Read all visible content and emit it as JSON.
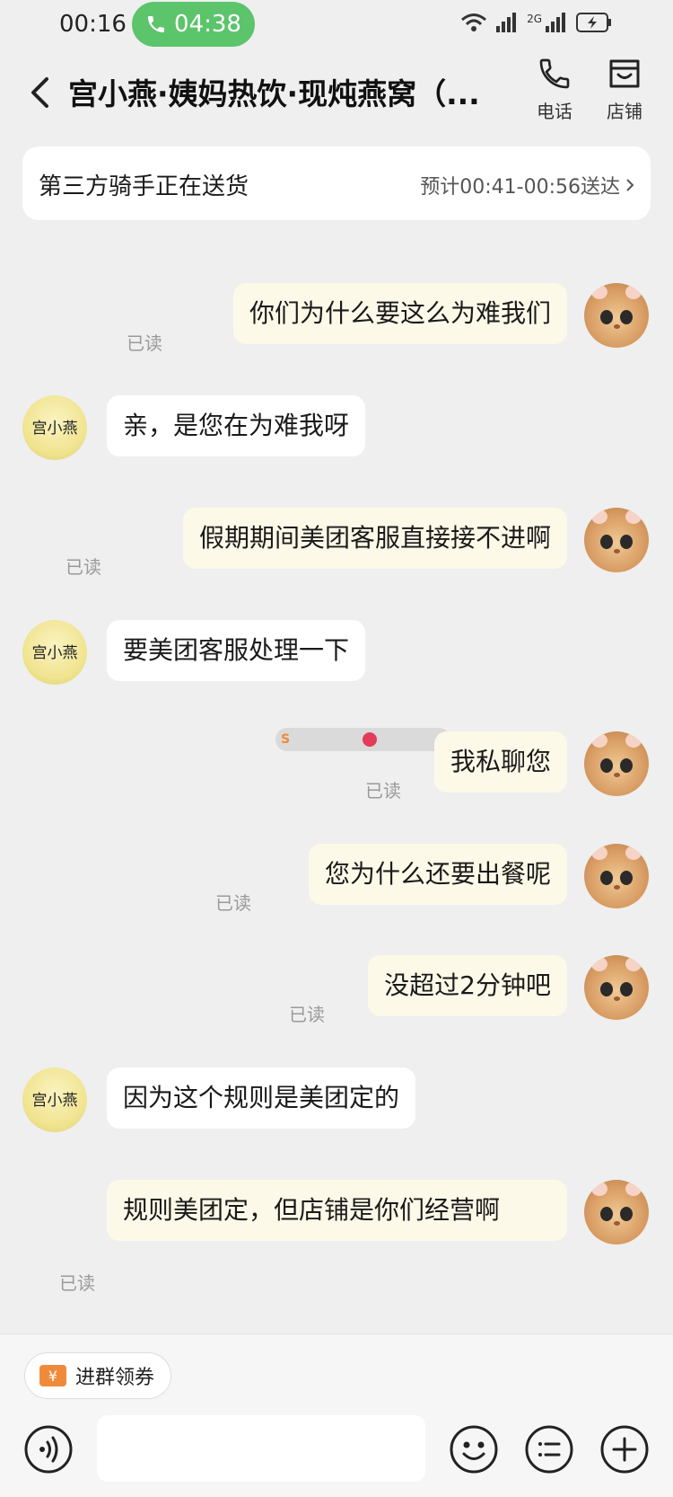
{
  "status_bar": {
    "time": "00:16",
    "call_duration": "04:38",
    "network_label": "2G"
  },
  "header": {
    "title": "宫小燕·姨妈热饮·现炖燕窝（...",
    "phone_label": "电话",
    "store_label": "店铺"
  },
  "delivery": {
    "status": "第三方骑手正在送货",
    "eta": "预计00:41-00:56送达"
  },
  "shop_avatar": {
    "logo_text": "宫小燕"
  },
  "messages": [
    {
      "side": "out",
      "text": "你们为什么要这么为难我们",
      "read": "已读"
    },
    {
      "side": "in",
      "text": "亲，是您在为难我呀"
    },
    {
      "side": "out",
      "text": "假期期间美团客服直接接不进啊",
      "read": "已读"
    },
    {
      "side": "in",
      "text": "要美团客服处理一下"
    },
    {
      "side": "out",
      "text": "我私聊您",
      "read": "已读"
    },
    {
      "side": "out",
      "text": "您为什么还要出餐呢",
      "read": "已读"
    },
    {
      "side": "out",
      "text": "没超过2分钟吧",
      "read": "已读"
    },
    {
      "side": "in",
      "text": "因为这个规则是美团定的"
    },
    {
      "side": "out",
      "text": "规则美团定，但店铺是你们经营啊",
      "read": "已读"
    }
  ],
  "bottom": {
    "coupon_label": "进群领券",
    "coupon_icon_text": "¥"
  },
  "colors": {
    "call_pill": "#5cc46b",
    "outgoing_bubble": "#fdf9e8",
    "incoming_bubble": "#ffffff",
    "background": "#efefef",
    "coupon_icon": "#f08a3b"
  }
}
